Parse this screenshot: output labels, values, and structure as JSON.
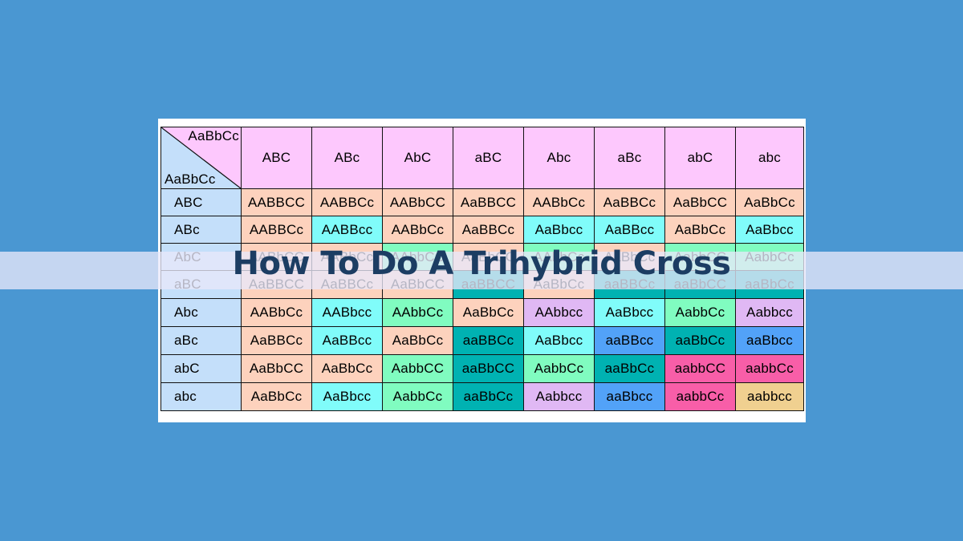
{
  "title": "How To Do A Trihybrid Cross",
  "colors": {
    "background": "#4a97d2",
    "header": "#fdc8fd",
    "row_header": "#c4dffa",
    "title_text": "#1c3d63"
  },
  "corner": {
    "top_parent": "AaBbCc",
    "left_parent": "AaBbCc"
  },
  "columns": [
    "ABC",
    "ABc",
    "AbC",
    "aBC",
    "Abc",
    "aBc",
    "abC",
    "abc"
  ],
  "rows": [
    {
      "gamete": "ABC",
      "cells": [
        {
          "g": "AABBCC",
          "c": "peach"
        },
        {
          "g": "AABBCc",
          "c": "peach"
        },
        {
          "g": "AABbCC",
          "c": "peach"
        },
        {
          "g": "AaBBCC",
          "c": "peach"
        },
        {
          "g": "AABbCc",
          "c": "peach"
        },
        {
          "g": "AaBBCc",
          "c": "peach"
        },
        {
          "g": "AaBbCC",
          "c": "peach"
        },
        {
          "g": "AaBbCc",
          "c": "peach"
        }
      ]
    },
    {
      "gamete": "ABc",
      "cells": [
        {
          "g": "AABBCc",
          "c": "peach"
        },
        {
          "g": "AABBcc",
          "c": "cyan"
        },
        {
          "g": "AABbCc",
          "c": "peach"
        },
        {
          "g": "AaBBCc",
          "c": "peach"
        },
        {
          "g": "AaBbcc",
          "c": "cyan"
        },
        {
          "g": "AaBBcc",
          "c": "cyan"
        },
        {
          "g": "AaBbCc",
          "c": "peach"
        },
        {
          "g": "AaBbcc",
          "c": "cyan"
        }
      ]
    },
    {
      "gamete": "AbC",
      "cells": [
        {
          "g": "AABbCC",
          "c": "peach"
        },
        {
          "g": "AABbCc",
          "c": "peach"
        },
        {
          "g": "AAbbCC",
          "c": "mint"
        },
        {
          "g": "AaBbCC",
          "c": "peach"
        },
        {
          "g": "AAbbCc",
          "c": "mint"
        },
        {
          "g": "AaBbCc",
          "c": "peach"
        },
        {
          "g": "AabbCC",
          "c": "mint"
        },
        {
          "g": "AabbCc",
          "c": "mint"
        }
      ]
    },
    {
      "gamete": "aBC",
      "cells": [
        {
          "g": "AaBBCC",
          "c": "peach"
        },
        {
          "g": "AaBBCc",
          "c": "peach"
        },
        {
          "g": "AaBbCC",
          "c": "peach"
        },
        {
          "g": "aaBBCC",
          "c": "teal"
        },
        {
          "g": "AaBbCc",
          "c": "peach"
        },
        {
          "g": "aaBBCc",
          "c": "teal"
        },
        {
          "g": "aaBbCC",
          "c": "teal"
        },
        {
          "g": "aaBbCc",
          "c": "teal"
        }
      ]
    },
    {
      "gamete": "Abc",
      "cells": [
        {
          "g": "AABbCc",
          "c": "peach"
        },
        {
          "g": "AABbcc",
          "c": "cyan"
        },
        {
          "g": "AAbbCc",
          "c": "mint"
        },
        {
          "g": "AaBbCc",
          "c": "peach"
        },
        {
          "g": "AAbbcc",
          "c": "lilac"
        },
        {
          "g": "AaBbcc",
          "c": "cyan"
        },
        {
          "g": "AabbCc",
          "c": "mint"
        },
        {
          "g": "Aabbcc",
          "c": "lilac"
        }
      ]
    },
    {
      "gamete": "aBc",
      "cells": [
        {
          "g": "AaBBCc",
          "c": "peach"
        },
        {
          "g": "AaBBcc",
          "c": "cyan"
        },
        {
          "g": "AaBbCc",
          "c": "peach"
        },
        {
          "g": "aaBBCc",
          "c": "teal"
        },
        {
          "g": "AaBbcc",
          "c": "cyan"
        },
        {
          "g": "aaBBcc",
          "c": "blue"
        },
        {
          "g": "aaBbCc",
          "c": "teal"
        },
        {
          "g": "aaBbcc",
          "c": "blue"
        }
      ]
    },
    {
      "gamete": "abC",
      "cells": [
        {
          "g": "AaBbCC",
          "c": "peach"
        },
        {
          "g": "AaBbCc",
          "c": "peach"
        },
        {
          "g": "AabbCC",
          "c": "mint"
        },
        {
          "g": "aaBbCC",
          "c": "teal"
        },
        {
          "g": "AabbCc",
          "c": "mint"
        },
        {
          "g": "aaBbCc",
          "c": "teal"
        },
        {
          "g": "aabbCC",
          "c": "pink"
        },
        {
          "g": "aabbCc",
          "c": "pink"
        }
      ]
    },
    {
      "gamete": "abc",
      "cells": [
        {
          "g": "AaBbCc",
          "c": "peach"
        },
        {
          "g": "AaBbcc",
          "c": "cyan"
        },
        {
          "g": "AabbCc",
          "c": "mint"
        },
        {
          "g": "aaBbCc",
          "c": "teal"
        },
        {
          "g": "Aabbcc",
          "c": "lilac"
        },
        {
          "g": "aaBbcc",
          "c": "blue"
        },
        {
          "g": "aabbCc",
          "c": "pink"
        },
        {
          "g": "aabbcc",
          "c": "tan"
        }
      ]
    }
  ]
}
